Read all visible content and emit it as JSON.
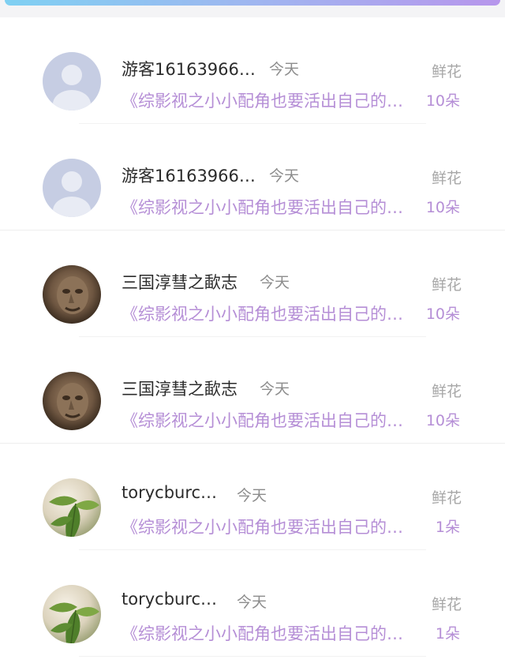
{
  "records": [
    {
      "name": "游客16163966…",
      "time": "今天",
      "gift_label": "鲜花",
      "book_title": "《综影视之小小配角也要活出自己的…",
      "amount": "10朵",
      "avatar": "default-person-icon"
    },
    {
      "name": "游客16163966…",
      "time": "今天",
      "gift_label": "鲜花",
      "book_title": "《综影视之小小配角也要活出自己的…",
      "amount": "10朵",
      "avatar": "default-person-icon"
    },
    {
      "name": "三国淳彗之歃志",
      "time": "今天",
      "gift_label": "鲜花",
      "book_title": "《综影视之小小配角也要活出自己的…",
      "amount": "10朵",
      "avatar": "statue-face-photo"
    },
    {
      "name": "三国淳彗之歃志",
      "time": "今天",
      "gift_label": "鲜花",
      "book_title": "《综影视之小小配角也要活出自己的…",
      "amount": "10朵",
      "avatar": "statue-face-photo"
    },
    {
      "name": "torycburc…",
      "time": "今天",
      "gift_label": "鲜花",
      "book_title": "《综影视之小小配角也要活出自己的…",
      "amount": "1朵",
      "avatar": "green-leaves-photo"
    },
    {
      "name": "torycburc…",
      "time": "今天",
      "gift_label": "鲜花",
      "book_title": "《综影视之小小配角也要活出自己的…",
      "amount": "1朵",
      "avatar": "green-leaves-photo"
    }
  ],
  "colors": {
    "accent_gradient_start": "#7fd0f2",
    "accent_gradient_end": "#b796ec",
    "title_purple": "#b58ed6",
    "name_text": "#2b2b2b",
    "muted_text": "#8c8c8c"
  }
}
